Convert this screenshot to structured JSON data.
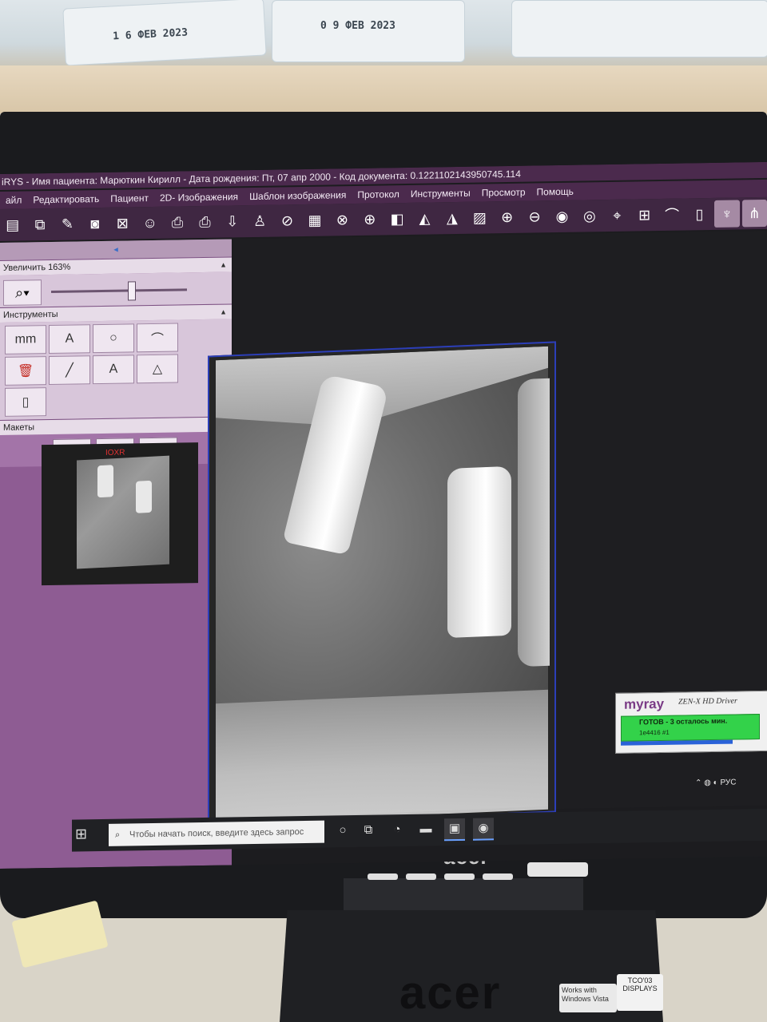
{
  "scene": {
    "packages": [
      {
        "date": "1 6  ФЕВ 2023"
      },
      {
        "date": "0 9  ФЕВ 2023"
      }
    ],
    "bezel_logo": "acer",
    "stand_logo": "acer",
    "sticker_windows": "Works with Windows Vista",
    "sticker_tco": "TCO'03 DISPLAYS"
  },
  "app": {
    "title": "iRYS - Имя пациента: Марюткин Кирилл - Дата рождения: Пт, 07 апр 2000 - Код документа: 0.1221102143950745.114",
    "menu": [
      "айл",
      "Редактировать",
      "Пациент",
      "2D- Изображения",
      "Шаблон изображения",
      "Протокол",
      "Инструменты",
      "Просмотр",
      "Помощь"
    ],
    "toolbar_icons": [
      "save-icon",
      "copy-icon",
      "save-as-icon",
      "camera-icon",
      "close-image-icon",
      "patient-icon",
      "print-icon",
      "printer-icon",
      "export-icon",
      "user-icon",
      "hide-icon",
      "layout-icon",
      "remove-image-icon",
      "acquire-icon",
      "compare-icon",
      "filter-icon",
      "sharpen-icon",
      "image-icon",
      "zoom-in-icon",
      "zoom-out-icon",
      "eye-icon",
      "eye-tool-icon",
      "ruler-eye-icon",
      "measure-icon",
      "curve-icon",
      "implant-icon",
      "tooth-icon",
      "nerve-icon",
      "grid-icon"
    ]
  },
  "sidepanel": {
    "zoom_label": "Увеличить 163%",
    "zoom_level_percent": 163,
    "tools_label": "Инструменты",
    "tools": [
      {
        "icon": "ruler-icon",
        "label": "mm"
      },
      {
        "icon": "angle-text-icon",
        "label": "A"
      },
      {
        "icon": "circle-icon",
        "label": "○"
      },
      {
        "icon": "curve-icon",
        "label": "⌒"
      },
      {
        "icon": "trash-icon",
        "label": "🗑"
      },
      {
        "icon": "line-icon",
        "label": "╱"
      },
      {
        "icon": "text-icon",
        "label": "A"
      },
      {
        "icon": "angle-icon",
        "label": "△"
      },
      {
        "icon": "implant-add-icon",
        "label": "▯"
      }
    ],
    "layouts_label": "Макеты",
    "layouts": [
      "▣",
      "⇪",
      "☷"
    ],
    "thumbnail_label": "IOXR"
  },
  "driver": {
    "brand": "myray",
    "name": "ZEN-X HD Driver",
    "status": "ГОТОВ - 3 осталось мин.",
    "device": "1e4416 #1"
  },
  "tray": {
    "lang": "РУС"
  },
  "taskbar": {
    "search_placeholder": "Чтобы начать поиск, введите здесь запрос"
  },
  "colors": {
    "accent": "#4b2a4d",
    "panel": "#8e5c93",
    "frame": "#2c3eb8",
    "status_green": "#33d24a"
  }
}
